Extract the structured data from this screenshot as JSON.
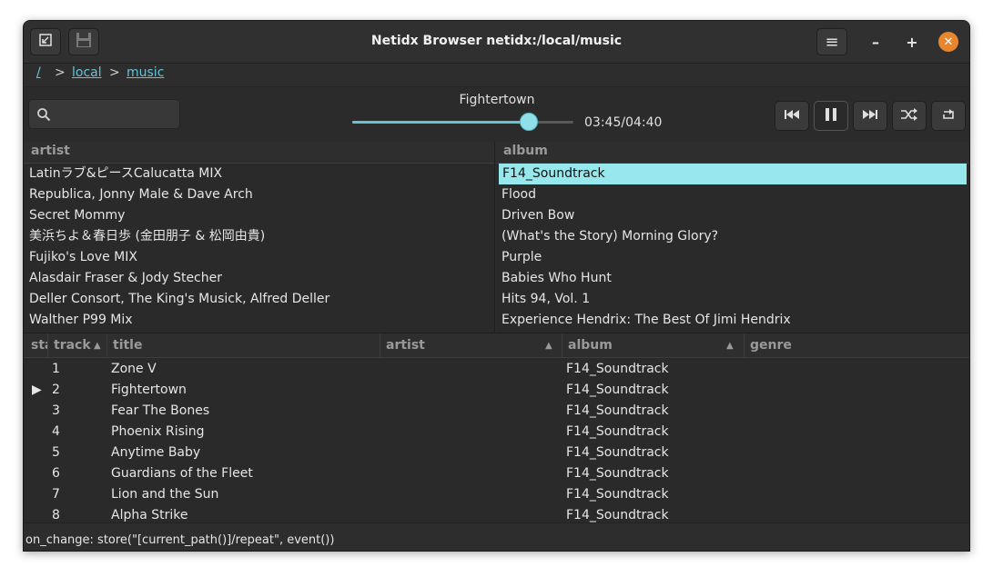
{
  "window": {
    "title": "Netidx Browser netidx:/local/music"
  },
  "breadcrumb": {
    "root": "/",
    "sep1": ">",
    "local": "local",
    "sep2": ">",
    "music": "music"
  },
  "header": {
    "menu_glyph": "≡",
    "min_glyph": "–",
    "max_glyph": "+",
    "close_glyph": "✕"
  },
  "search": {
    "placeholder": ""
  },
  "player": {
    "now_playing": "Fightertown",
    "time": "03:45/04:40",
    "progress": 0.8
  },
  "icons": {
    "left_button": "go-back-icon",
    "save_button": "save-icon",
    "prev": "skip-previous-icon",
    "pause": "pause-icon",
    "next": "skip-next-icon",
    "shuffle": "shuffle-icon",
    "repeat": "repeat-icon",
    "search": "search-icon"
  },
  "colors": {
    "accent": "#64c4d6",
    "selected_row": "#96e8ec",
    "close": "#e8862e"
  },
  "artist_pane": {
    "header": "artist",
    "items": [
      "Latinラブ&ピースCalucatta MIX",
      "Republica, Jonny Male & Dave Arch",
      "Secret Mommy",
      "美浜ちよ＆春日歩 (金田朋子 & 松岡由貴)",
      "Fujiko's Love MIX",
      "Alasdair Fraser & Jody Stecher",
      "Deller Consort, The King's Musick, Alfred Deller",
      "Walther P99 Mix"
    ]
  },
  "album_pane": {
    "header": "album",
    "items": [
      "F14_Soundtrack",
      "Flood",
      "Driven Bow",
      "(What's the Story) Morning Glory?",
      "Purple",
      "Babies Who Hunt",
      "Hits 94, Vol. 1",
      "Experience Hendrix: The Best Of Jimi Hendrix"
    ],
    "selected_index": 0
  },
  "tracks_table": {
    "columns": {
      "state": "sta",
      "track": "track",
      "title": "title",
      "artist": "artist",
      "album": "album",
      "genre": "genre"
    },
    "rows": [
      {
        "state": "",
        "track": "1",
        "title": "Zone V",
        "artist": "",
        "album": "F14_Soundtrack",
        "genre": ""
      },
      {
        "state": "▶",
        "track": "2",
        "title": "Fightertown",
        "artist": "",
        "album": "F14_Soundtrack",
        "genre": ""
      },
      {
        "state": "",
        "track": "3",
        "title": "Fear The Bones",
        "artist": "",
        "album": "F14_Soundtrack",
        "genre": ""
      },
      {
        "state": "",
        "track": "4",
        "title": "Phoenix Rising",
        "artist": "",
        "album": "F14_Soundtrack",
        "genre": ""
      },
      {
        "state": "",
        "track": "5",
        "title": "Anytime Baby",
        "artist": "",
        "album": "F14_Soundtrack",
        "genre": ""
      },
      {
        "state": "",
        "track": "6",
        "title": "Guardians of the Fleet",
        "artist": "",
        "album": "F14_Soundtrack",
        "genre": ""
      },
      {
        "state": "",
        "track": "7",
        "title": "Lion and the Sun",
        "artist": "",
        "album": "F14_Soundtrack",
        "genre": ""
      },
      {
        "state": "",
        "track": "8",
        "title": "Alpha Strike",
        "artist": "",
        "album": "F14_Soundtrack",
        "genre": ""
      }
    ]
  },
  "status": {
    "text": "on_change: store(\"[current_path()]/repeat\", event())"
  }
}
